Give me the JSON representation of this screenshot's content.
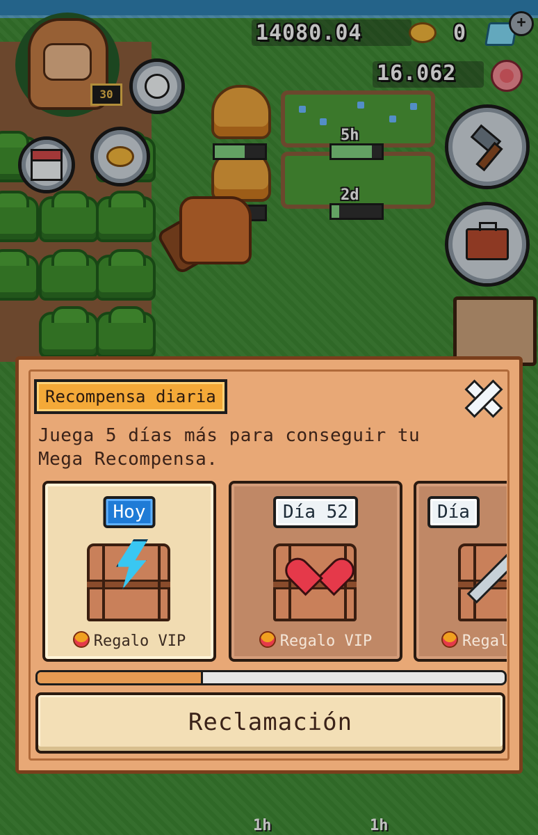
{
  "hud": {
    "coins": "14080.04",
    "gems": "0",
    "flowers": "16.062",
    "player_level": "30"
  },
  "scene": {
    "plot_timers": [
      {
        "label": "5h",
        "progress": 0.8
      },
      {
        "label": "2d",
        "progress": 0.15
      }
    ],
    "beehive_progress": [
      0.6,
      0.5
    ],
    "bottom_timers": [
      "1h",
      "1h"
    ]
  },
  "dialog": {
    "title": "Recompensa diaria",
    "description": "Juega 5 días más para conseguir tu Mega Recompensa.",
    "cards": [
      {
        "day_label": "Hoy",
        "reward_label": "Regalo VIP",
        "reward_icon": "energy-bolt-icon",
        "state": "today"
      },
      {
        "day_label": "Día 52",
        "reward_label": "Regalo VIP",
        "reward_icon": "heart-icon",
        "state": "future"
      },
      {
        "day_label": "Día",
        "reward_label": "Regalo VIP",
        "reward_icon": "sword-icon",
        "state": "future"
      }
    ],
    "progress": 0.35,
    "claim_label": "Reclamación"
  },
  "colors": {
    "dialog_bg": "#e8a876",
    "dialog_border": "#7a3f1c",
    "today_badge": "#1f7bd6",
    "title_chip": "#f4a938",
    "progress_fill": "#e69a52",
    "grass": "#3f8a34"
  }
}
